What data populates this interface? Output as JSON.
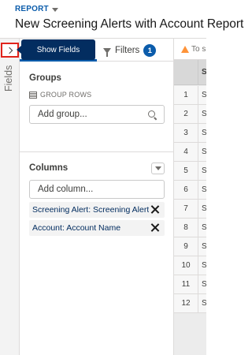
{
  "header": {
    "report_label": "REPORT",
    "title": "New Screening Alerts with Account Report"
  },
  "rail": {
    "label": "Fields"
  },
  "tooltip": {
    "text": "Show Fields"
  },
  "tabs": {
    "filters_label": "Filters",
    "filters_count": "1"
  },
  "groups": {
    "title": "Groups",
    "group_rows_label": "GROUP ROWS",
    "search_placeholder": "Add group..."
  },
  "columns": {
    "title": "Columns",
    "search_placeholder": "Add column...",
    "items": [
      {
        "label": "Screening Alert: Screening Alert N"
      },
      {
        "label": "Account: Account Name"
      }
    ]
  },
  "grid": {
    "warning_text": "To s",
    "header_cell": "S",
    "rows": [
      {
        "num": "1",
        "cell": "S"
      },
      {
        "num": "2",
        "cell": "S"
      },
      {
        "num": "3",
        "cell": "S"
      },
      {
        "num": "4",
        "cell": "S"
      },
      {
        "num": "5",
        "cell": "S"
      },
      {
        "num": "6",
        "cell": "S"
      },
      {
        "num": "7",
        "cell": "S"
      },
      {
        "num": "8",
        "cell": "S"
      },
      {
        "num": "9",
        "cell": "S"
      },
      {
        "num": "10",
        "cell": "S"
      },
      {
        "num": "11",
        "cell": "S"
      },
      {
        "num": "12",
        "cell": "S"
      }
    ]
  }
}
